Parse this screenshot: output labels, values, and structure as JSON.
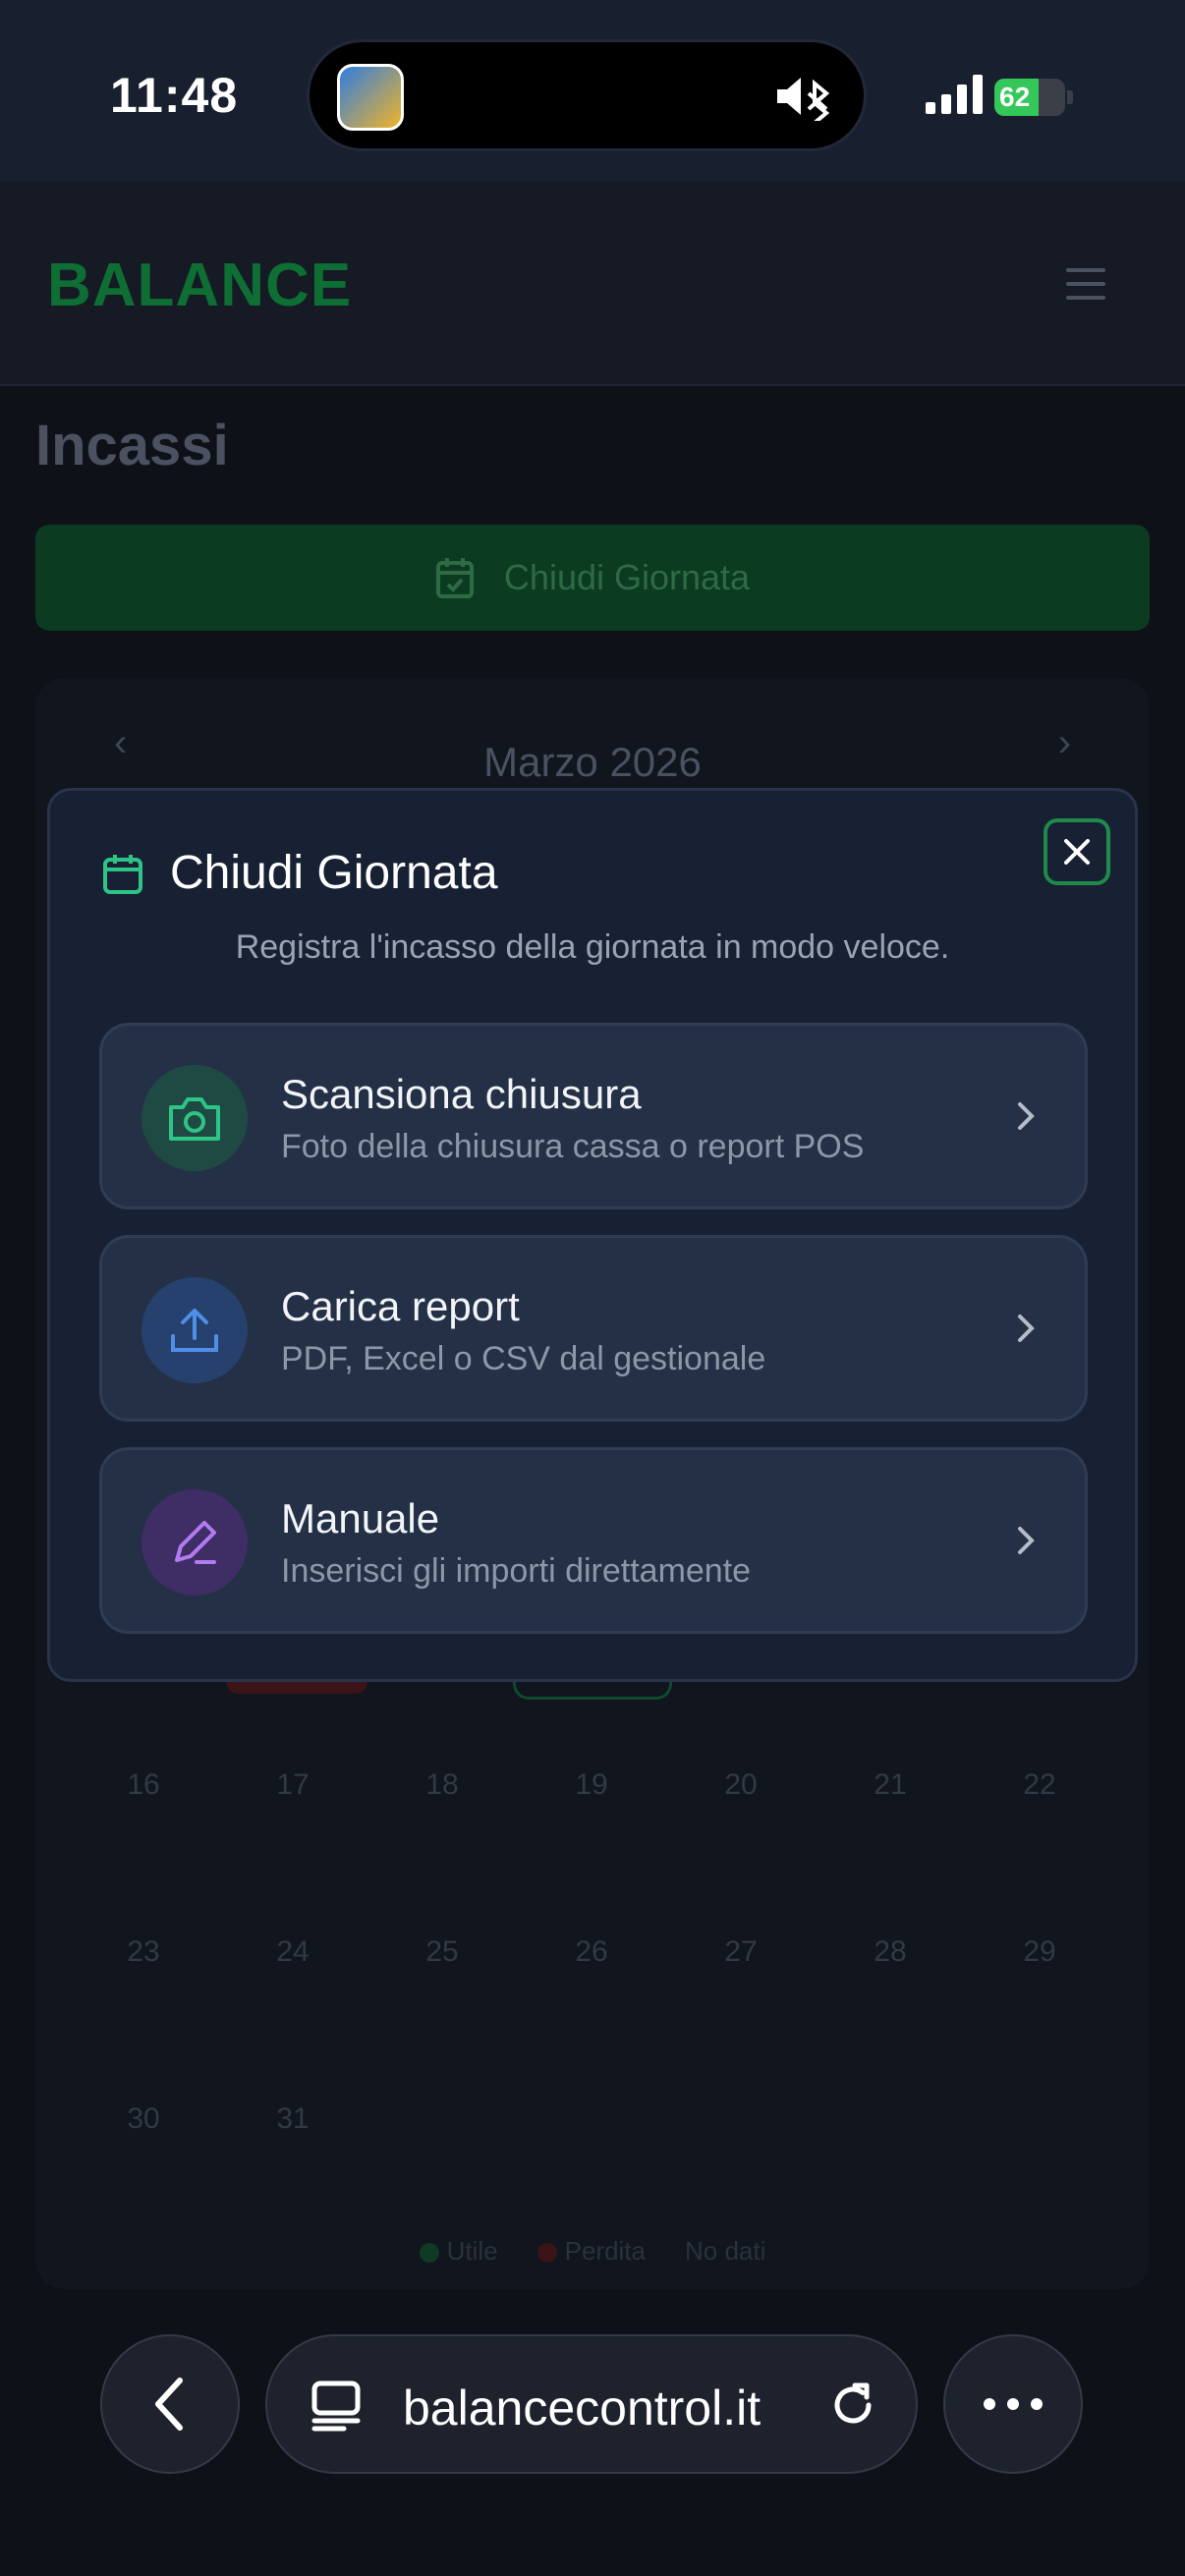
{
  "status_bar": {
    "time": "11:48",
    "battery": "62",
    "battery_level": 0.62
  },
  "app": {
    "brand": "BALANCE",
    "page_title": "Incassi",
    "close_day_button": "Chiudi Giornata"
  },
  "calendar": {
    "month_label": "Marzo 2026",
    "rows": [
      [
        "16",
        "17",
        "18",
        "19",
        "20",
        "21",
        "22"
      ],
      [
        "23",
        "24",
        "25",
        "26",
        "27",
        "28",
        "29"
      ],
      [
        "30",
        "31"
      ]
    ],
    "legend": [
      "Utile",
      "Perdita",
      "No dati"
    ]
  },
  "modal": {
    "title": "Chiudi Giornata",
    "subtitle": "Registra l'incasso della giornata in modo veloce.",
    "options": [
      {
        "title": "Scansiona chiusura",
        "desc": "Foto della chiusura cassa o report POS",
        "icon": "camera-icon"
      },
      {
        "title": "Carica report",
        "desc": "PDF, Excel o CSV dal gestionale",
        "icon": "upload-icon"
      },
      {
        "title": "Manuale",
        "desc": "Inserisci gli importi direttamente",
        "icon": "pen-icon"
      }
    ]
  },
  "browser": {
    "url": "balancecontrol.it"
  },
  "colors": {
    "accent": "#2ec486",
    "upload": "#4f8fe8",
    "pen": "#b27cf0",
    "background": "#0e1117"
  }
}
